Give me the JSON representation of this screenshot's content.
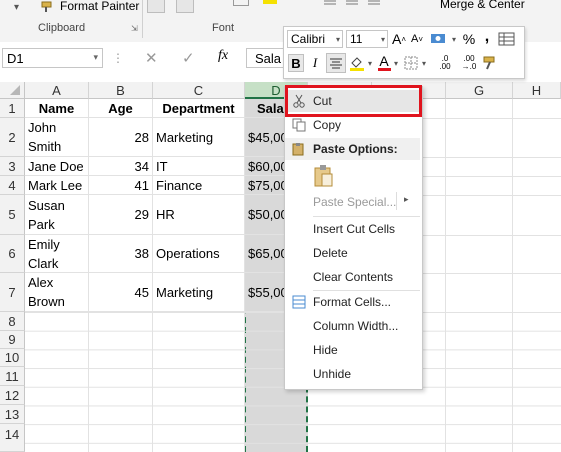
{
  "ribbon": {
    "format_painter": "Format Painter",
    "clipboard_label": "Clipboard",
    "font_label": "Font",
    "merge_center": "Merge & Center"
  },
  "formula_bar": {
    "name_box": "D1",
    "fx": "fx",
    "content": "Sala"
  },
  "mini_toolbar": {
    "font_name": "Calibri",
    "font_size": "11",
    "grow": "A",
    "shrink": "A",
    "currency": "$",
    "percent": "%",
    "comma": ",",
    "bold": "B",
    "italic": "I",
    "font_color_letter": "A",
    "inc_decimal": ".0\n.00",
    "dec_decimal": ".00\n→.0"
  },
  "columns": [
    "A",
    "B",
    "C",
    "D",
    "E",
    "F",
    "G",
    "H"
  ],
  "rows": [
    "1",
    "2",
    "3",
    "4",
    "5",
    "6",
    "7",
    "8",
    "9",
    "10",
    "11",
    "12",
    "13",
    "14"
  ],
  "sheet": {
    "header": {
      "name": "Name",
      "age": "Age",
      "department": "Department",
      "salary": "Sala"
    },
    "data": [
      {
        "name": "John Smith",
        "age": "28",
        "department": "Marketing",
        "salary": "$45,00"
      },
      {
        "name": "Jane Doe",
        "age": "34",
        "department": "IT",
        "salary": "$60,00"
      },
      {
        "name": "Mark Lee",
        "age": "41",
        "department": "Finance",
        "salary": "$75,00"
      },
      {
        "name": "Susan Park",
        "age": "29",
        "department": "HR",
        "salary": "$50,00"
      },
      {
        "name": "Emily Clark",
        "age": "38",
        "department": "Operations",
        "salary": "$65,00"
      },
      {
        "name": "Alex Brown",
        "age": "45",
        "department": "Marketing",
        "salary": "$55,00"
      }
    ]
  },
  "context_menu": {
    "cut": "Cut",
    "copy": "Copy",
    "paste_options": "Paste Options:",
    "paste_special": "Paste Special...",
    "insert_cut_cells": "Insert Cut Cells",
    "delete": "Delete",
    "clear_contents": "Clear Contents",
    "format_cells": "Format Cells...",
    "column_width": "Column Width...",
    "hide": "Hide",
    "unhide": "Unhide"
  },
  "colors": {
    "highlight_box": "#e0141e",
    "selected_column": "#d9d9d9",
    "selected_header": "#c6e0c6",
    "cut_marquee": "#217346"
  }
}
